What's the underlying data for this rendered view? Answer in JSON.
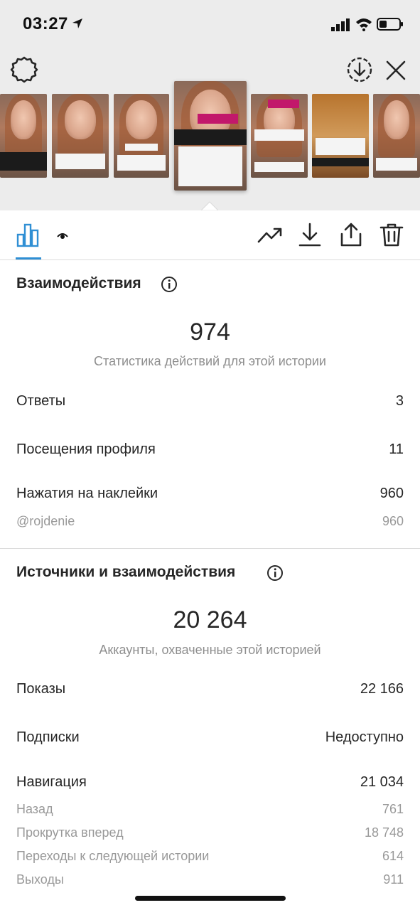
{
  "status": {
    "time": "03:27"
  },
  "tabs": {
    "active": "insights"
  },
  "story_thumbs": {
    "active_tag": "@rojdenie"
  },
  "interactions": {
    "title": "Взаимодействия",
    "total": "974",
    "total_label": "Статистика действий для этой истории",
    "rows": [
      {
        "label": "Ответы",
        "value": "3"
      },
      {
        "label": "Посещения профиля",
        "value": "11"
      },
      {
        "label": "Нажатия на наклейки",
        "value": "960"
      }
    ],
    "sticker_sub": {
      "label": "@rojdenie",
      "value": "960"
    }
  },
  "discovery": {
    "title": "Источники и взаимодействия",
    "total": "20 264",
    "total_label": "Аккаунты, охваченные этой историей",
    "rows": [
      {
        "label": "Показы",
        "value": "22 166"
      },
      {
        "label": "Подписки",
        "value": "Недоступно"
      },
      {
        "label": "Навигация",
        "value": "21 034"
      }
    ],
    "navigation_sub": [
      {
        "label": "Назад",
        "value": "761"
      },
      {
        "label": "Прокрутка вперед",
        "value": "18 748"
      },
      {
        "label": "Переходы к следующей истории",
        "value": "614"
      },
      {
        "label": "Выходы",
        "value": "911"
      }
    ]
  },
  "colors": {
    "accent": "#2f8fd4",
    "tag": "#c2186b",
    "muted": "#8e8e8e"
  }
}
